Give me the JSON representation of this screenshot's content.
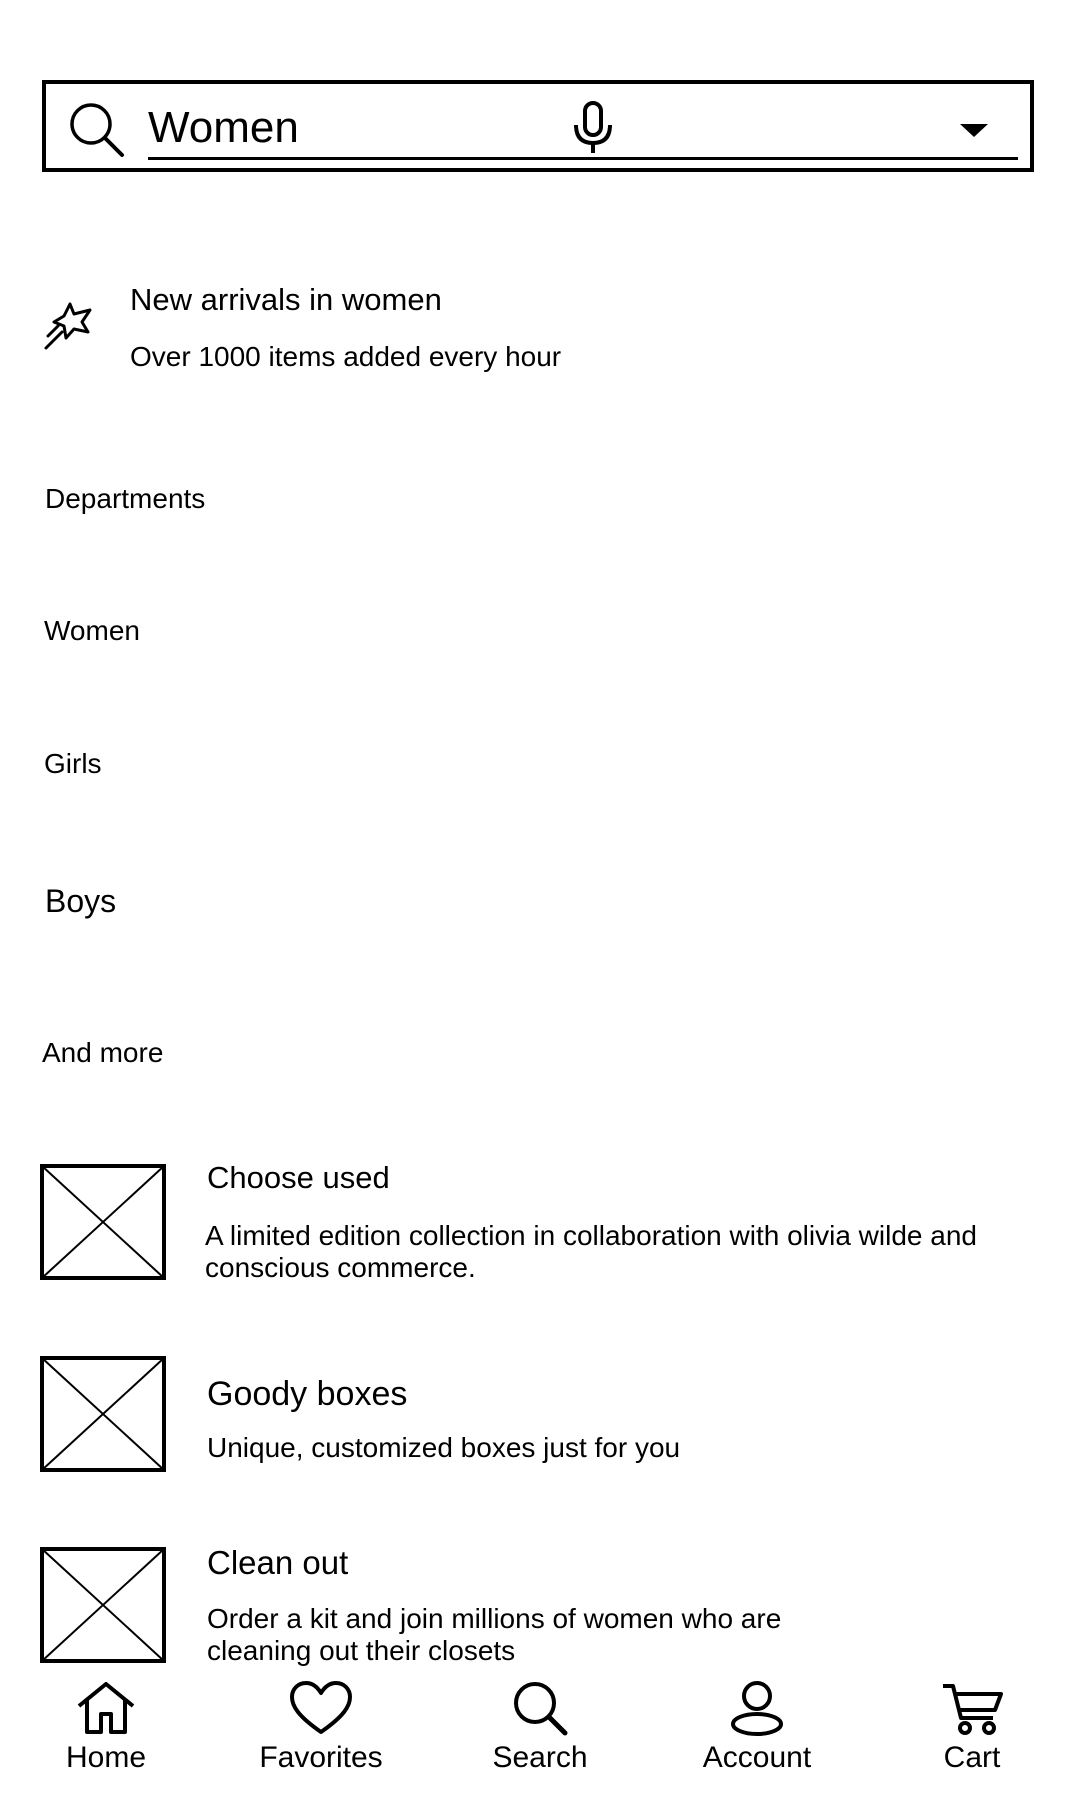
{
  "search": {
    "value": "Women",
    "icons": {
      "search": "search-icon",
      "mic": "mic-icon",
      "dropdown": "chevron-down-icon"
    }
  },
  "promo": {
    "icon": "shooting-star-icon",
    "title": "New arrivals in women",
    "subtitle": "Over 1000 items added every hour"
  },
  "departments": {
    "heading": "Departments",
    "items": [
      "Women",
      "Girls",
      "Boys"
    ],
    "more": "And more"
  },
  "cards": [
    {
      "title": "Choose used",
      "description": "A limited edition collection in collaboration with olivia wilde and conscious commerce."
    },
    {
      "title": "Goody boxes",
      "description": "Unique, customized boxes just for you"
    },
    {
      "title": "Clean out",
      "description": "Order a kit and join millions of women who are cleaning out their closets"
    }
  ],
  "nav": [
    {
      "label": "Home",
      "icon": "home-icon"
    },
    {
      "label": "Favorites",
      "icon": "heart-icon"
    },
    {
      "label": "Search",
      "icon": "search-icon"
    },
    {
      "label": "Account",
      "icon": "account-icon"
    },
    {
      "label": "Cart",
      "icon": "cart-icon"
    }
  ]
}
